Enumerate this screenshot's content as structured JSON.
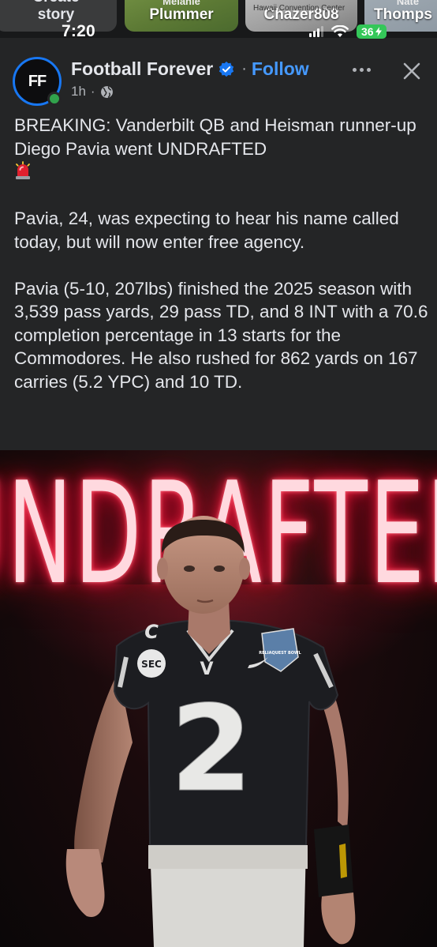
{
  "stories": [
    {
      "name": "Create\nstory",
      "type": "create"
    },
    {
      "name": "Plummer",
      "cover_text": "Melanie"
    },
    {
      "name": "Chazer808",
      "cover_text": "Hawaii Convention Center"
    },
    {
      "name": "Thomps",
      "cover_text": "Nate"
    }
  ],
  "status_bar": {
    "time": "7:20",
    "battery": "36"
  },
  "post": {
    "author": "Football Forever",
    "avatar_text": "FF",
    "verified": true,
    "follow_label": "Follow",
    "time_ago": "1h",
    "audience_icon": "globe-icon",
    "paragraphs": [
      "BREAKING: Vanderbilt QB and Heisman runner-up Diego Pavia went UNDRAFTED",
      "Pavia, 24, was expecting to hear his name called today, but will now enter free agency.",
      "Pavia (5-10, 207lbs) finished the 2025 season with 3,539 pass yards, 29 pass TD, and 8 INT with a 70.6 completion percentage in 13 starts for the Commodores. He also rushed for 862 yards on 167 carries (5.2 YPC) and 10 TD."
    ],
    "image": {
      "headline": "UNDRAFTED",
      "jersey_number": "2",
      "jersey_letter": "V",
      "patch_captain": "C",
      "patch_sec": "SEC",
      "patch_bowl": "RELIAQUEST BOWL"
    }
  },
  "colors": {
    "background": "#242526",
    "text": "#e4e6eb",
    "secondary_text": "#b0b3b8",
    "follow": "#4599ff",
    "verified": "#1877f2",
    "online": "#31a24c",
    "battery": "#34c759",
    "neon": "#ff2446"
  }
}
